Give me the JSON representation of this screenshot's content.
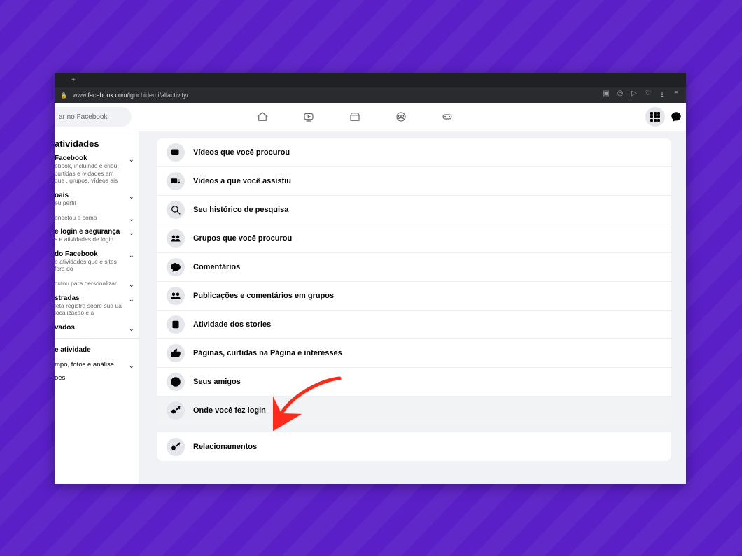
{
  "browser": {
    "url_host": "facebook.com",
    "url_prefix": "www.",
    "url_path": "/igor.hidemi/allactivity/"
  },
  "header": {
    "search_placeholder": "ar no Facebook"
  },
  "sidebar": {
    "title": "atividades",
    "items": [
      {
        "title": "Facebook",
        "desc": "ebook, incluindo ê criou, curtidas e ividades em que , grupos, vídeos ais",
        "chevron": true
      },
      {
        "title": "oais",
        "desc": "eu perfil",
        "chevron": true
      },
      {
        "title": "",
        "desc": "onectou e como",
        "chevron": true
      },
      {
        "title": "e login e segurança",
        "desc": "s e atividades de login",
        "chevron": true
      },
      {
        "title": "do Facebook",
        "desc": "e atividades que e sites fora do",
        "chevron": true
      },
      {
        "title": "",
        "desc": "cutou para personalizar",
        "chevron": true
      },
      {
        "title": "stradas",
        "desc": "leta registra sobre sua ua localização e a",
        "chevron": true
      },
      {
        "title": "vados",
        "desc": "",
        "chevron": true
      }
    ],
    "footer": {
      "line1": "e atividade",
      "line2": "mpo, fotos e análise",
      "line3": "oes"
    }
  },
  "rows": [
    {
      "icon": "video-search",
      "label": "Vídeos que você procurou"
    },
    {
      "icon": "video-play",
      "label": "Vídeos a que você assistiu"
    },
    {
      "icon": "search",
      "label": "Seu histórico de pesquisa"
    },
    {
      "icon": "groups",
      "label": "Grupos que você procurou"
    },
    {
      "icon": "comment",
      "label": "Comentários"
    },
    {
      "icon": "groups",
      "label": "Publicações e comentários em grupos"
    },
    {
      "icon": "stories",
      "label": "Atividade dos stories"
    },
    {
      "icon": "like",
      "label": "Páginas, curtidas na Página e interesses"
    },
    {
      "icon": "fb",
      "label": "Seus amigos"
    },
    {
      "icon": "key",
      "label": "Onde você fez login",
      "highlight": true
    },
    {
      "icon": "key",
      "label": "Relacionamentos"
    }
  ],
  "annotation": {
    "arrow_color": "#ff2a1a"
  }
}
